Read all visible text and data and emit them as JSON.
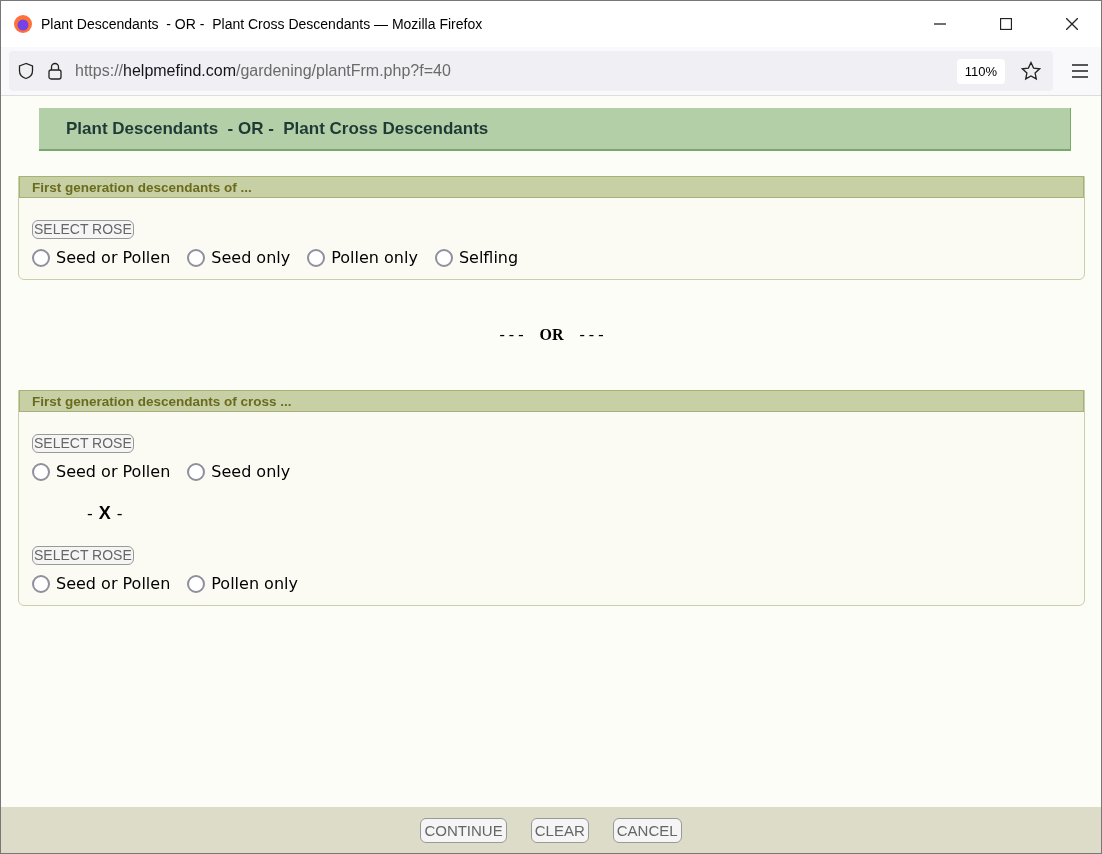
{
  "window": {
    "title": "Plant Descendants  - OR -  Plant Cross Descendants — Mozilla Firefox"
  },
  "address_bar": {
    "scheme": "https://",
    "domain": "helpmefind.com",
    "path": "/gardening/plantFrm.php?f=40",
    "zoom": "110%"
  },
  "heading": "Plant Descendants  - OR -  Plant Cross Descendants",
  "sections": [
    {
      "title": "First generation descendants of ...",
      "items": [
        {
          "kind": "picker",
          "button": "SELECT ROSE",
          "options": [
            {
              "label": "Seed or Pollen",
              "selected": false
            },
            {
              "label": "Seed only",
              "selected": false
            },
            {
              "label": "Pollen only",
              "selected": false
            },
            {
              "label": "Selfling",
              "selected": false
            }
          ]
        }
      ]
    },
    {
      "title": "First generation descendants of cross ...",
      "items": [
        {
          "kind": "picker",
          "button": "SELECT ROSE",
          "options": [
            {
              "label": "Seed or Pollen",
              "selected": false
            },
            {
              "label": "Seed only",
              "selected": false
            }
          ]
        },
        {
          "kind": "separator",
          "left": "-",
          "mark": "X",
          "right": "-"
        },
        {
          "kind": "picker",
          "button": "SELECT ROSE",
          "options": [
            {
              "label": "Seed or Pollen",
              "selected": false
            },
            {
              "label": "Pollen only",
              "selected": false
            }
          ]
        }
      ]
    }
  ],
  "divider": {
    "left": "- - -",
    "label": "OR",
    "right": "- - -"
  },
  "footer_buttons": [
    "CONTINUE",
    "CLEAR",
    "CANCEL"
  ]
}
